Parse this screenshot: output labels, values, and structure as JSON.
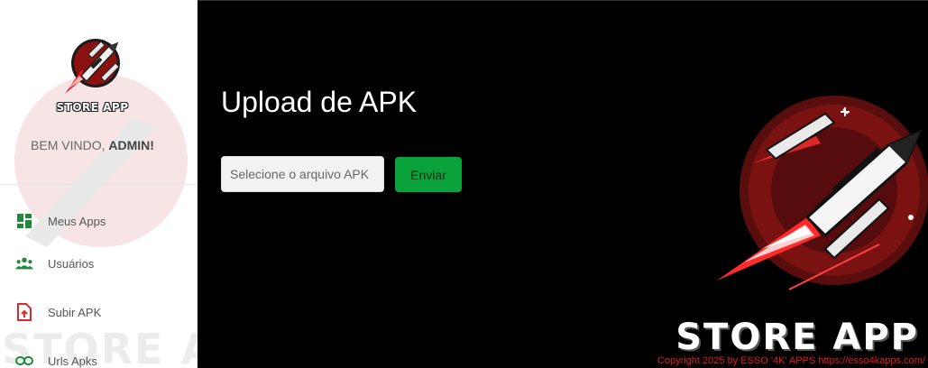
{
  "sidebar": {
    "logo_text": "STORE APP",
    "watermark_text": "STORE APP",
    "welcome_prefix": "BEM VINDO, ",
    "welcome_user": "ADMIN!",
    "items": [
      {
        "label": "Meus Apps",
        "icon": "dashboard-icon",
        "color": "#1e8a3a"
      },
      {
        "label": "Usuários",
        "icon": "users-icon",
        "color": "#1e8a3a"
      },
      {
        "label": "Subir APK",
        "icon": "file-upload-icon",
        "color": "#d92b2b"
      },
      {
        "label": "Urls Apks",
        "icon": "link-icon",
        "color": "#1e8a3a"
      }
    ]
  },
  "main": {
    "title": "Upload de APK",
    "file_placeholder": "Selecione o arquivo APK",
    "send_label": "Enviar",
    "brand_text": "STORE APP",
    "copyright": "Copyright 2025  by ESSO '4K' APPS https://esso4kapps.com/"
  },
  "colors": {
    "accent_green": "#0aa33b",
    "brand_red": "#e21b1b"
  }
}
